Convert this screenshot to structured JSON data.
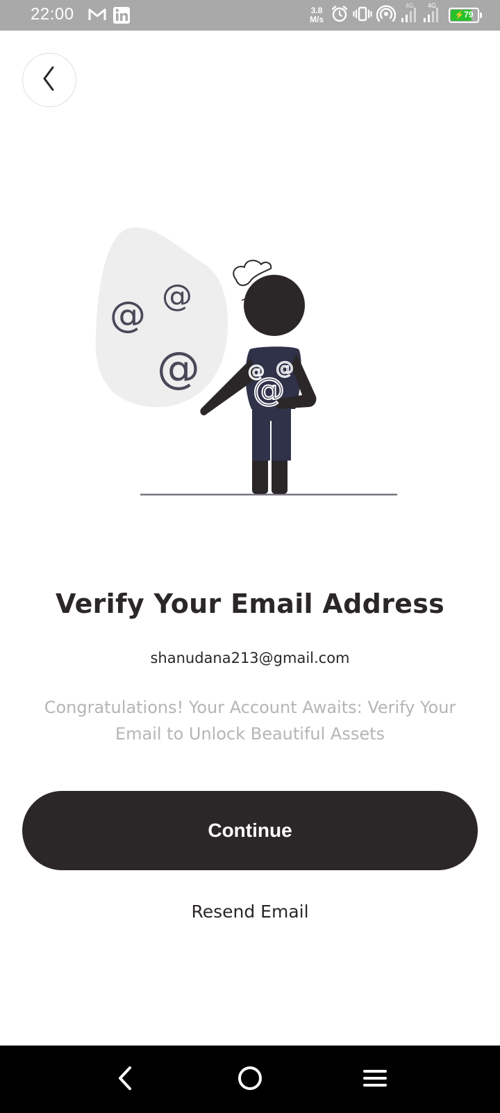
{
  "status_bar": {
    "time": "22:00",
    "net_speed_value": "3.8",
    "net_speed_unit": "M/s",
    "network_1": "4G",
    "network_2": "4G",
    "battery_level": "79",
    "battery_fraction": 0.79,
    "icons": [
      "gmail-icon",
      "linkedin-icon",
      "alarm-icon",
      "vibrate-icon",
      "hotspot-icon",
      "signal-icon",
      "battery-icon"
    ]
  },
  "header": {
    "back_icon": "chevron-left-icon"
  },
  "illustration": {
    "symbol": "@"
  },
  "main": {
    "title": "Verify Your Email Address",
    "email": "shanudana213@gmail.com",
    "subtitle": "Congratulations! Your Account Awaits: Verify Your Email to Unlock Beautiful Assets",
    "continue_label": "Continue",
    "resend_label": "Resend Email"
  },
  "nav": {
    "back": "back-icon",
    "home": "home-icon",
    "menu": "menu-icon"
  },
  "colors": {
    "primary": "#2b2728",
    "muted_text": "#b5b5b5",
    "status_bar": "#a9a9a9",
    "battery": "#27c12b"
  }
}
